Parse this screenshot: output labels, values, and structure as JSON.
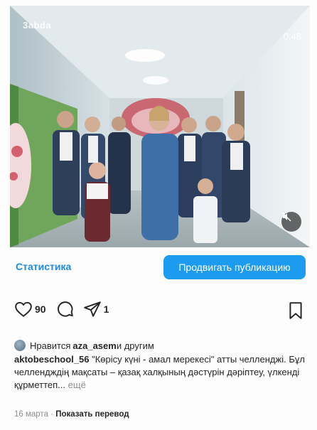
{
  "video": {
    "brand": "3abda",
    "duration": "0:48"
  },
  "actions": {
    "stats_label": "Статистика",
    "promote_label": "Продвигать публикацию"
  },
  "engagement": {
    "likes": "90",
    "shares": "1"
  },
  "liked_by": {
    "prefix": "Нравится ",
    "user": "aza_asem",
    "suffix": " и другим"
  },
  "caption": {
    "username": "aktobeschool_56",
    "text": " \"Көрісу күні - амал мерекесі\" атты челленджі. Бұл челлендждің мақсаты – қазақ халқының дәстүрін дәріптеу, үлкенді құрметтеп...",
    "more": " ещё"
  },
  "meta": {
    "date": "16 марта",
    "separator": " · ",
    "translate": "Показать перевод"
  },
  "colors": {
    "accent": "#1d9bf0",
    "link": "#1e88e5"
  }
}
